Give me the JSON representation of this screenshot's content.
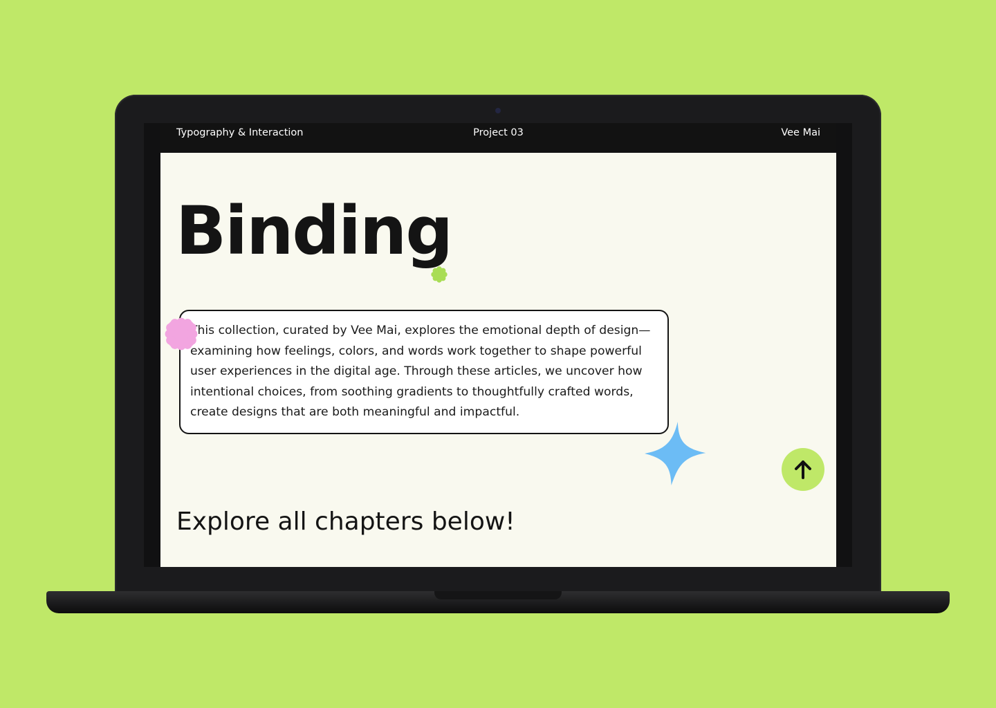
{
  "header": {
    "left": "Typography & Interaction",
    "center": "Project 03",
    "right": "Vee Mai"
  },
  "hero": {
    "title": "Binding"
  },
  "description": "This collection, curated by Vee Mai, explores the emotional depth of design—examining how feelings, colors, and words work together to shape powerful user experiences in the digital age. Through these articles, we uncover how intentional choices, from soothing gradients to thoughtfully crafted words, create designs that are both meaningful and impactful.",
  "chapters_heading": "Explore all chapters below!",
  "colors": {
    "background": "#bfe868",
    "screen": "#f9f9ef",
    "header": "#121212",
    "accent_green": "#bfe868",
    "accent_pink": "#f2a5e0",
    "accent_blue": "#6cbcf5",
    "text": "#141414"
  },
  "icons": {
    "scroll_top": "arrow-up-icon",
    "decor_1": "flower-icon",
    "decor_2": "flower-icon",
    "decor_3": "sparkle-star-icon"
  }
}
